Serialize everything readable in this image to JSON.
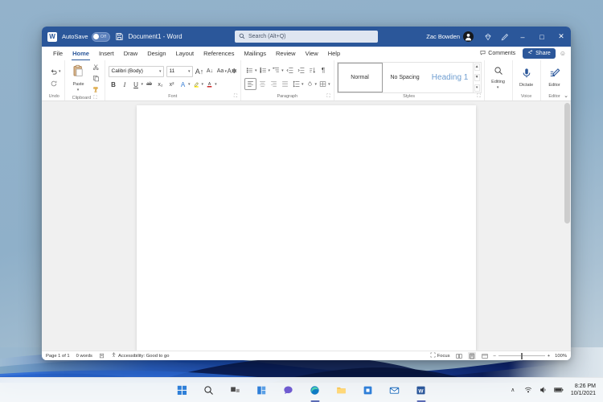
{
  "desktop": {
    "wallpaper_name": "windows-11-bloom",
    "bg_color": "#8fb0c9"
  },
  "window": {
    "titlebar": {
      "app_icon": "word-icon",
      "autosave_label": "AutoSave",
      "autosave_state": "Off",
      "save_icon": "save-icon",
      "document_title": "Document1  -  Word",
      "search_icon": "search-icon",
      "search_placeholder": "Search (Alt+Q)",
      "search_value": "",
      "search_dictate_icon": "microphone-icon",
      "user_name": "Zac Bowden",
      "avatar_icon": "avatar-icon",
      "diamond_icon": "microsoft-365-icon",
      "pen_icon": "ink-pen-icon",
      "minimize_label": "–",
      "maximize_label": "□",
      "close_label": "✕"
    },
    "tabs": [
      {
        "label": "File",
        "active": false
      },
      {
        "label": "Home",
        "active": true
      },
      {
        "label": "Insert",
        "active": false
      },
      {
        "label": "Draw",
        "active": false
      },
      {
        "label": "Design",
        "active": false
      },
      {
        "label": "Layout",
        "active": false
      },
      {
        "label": "References",
        "active": false
      },
      {
        "label": "Mailings",
        "active": false
      },
      {
        "label": "Review",
        "active": false
      },
      {
        "label": "View",
        "active": false
      },
      {
        "label": "Help",
        "active": false
      }
    ],
    "tabs_right": {
      "comments_label": "Comments",
      "comments_icon": "comment-icon",
      "share_label": "Share",
      "share_icon": "share-icon",
      "emoji_label": "☺"
    },
    "ribbon": {
      "undo": {
        "label": "Undo",
        "undo_icon": "undo-arrow-icon",
        "redo_icon": "redo-arrow-icon"
      },
      "clipboard": {
        "label": "Clipboard",
        "paste_label": "Paste",
        "paste_icon": "clipboard-icon",
        "cut_icon": "scissors-icon",
        "copy_icon": "copy-icon",
        "format_painter_icon": "format-painter-icon",
        "dialog_icon": "dialog-launcher-icon"
      },
      "font": {
        "label": "Font",
        "font_name": "Calibri (Body)",
        "font_size": "11",
        "grow_font_label": "A",
        "shrink_font_label": "A",
        "change_case_label": "Aa",
        "clear_formatting_label": "A",
        "bold_label": "B",
        "italic_label": "I",
        "underline_label": "U",
        "strikethrough_label": "ab",
        "subscript_label": "x₂",
        "superscript_label": "x²",
        "text_effects_label": "A",
        "highlight_label": "✎",
        "font_color_label": "A",
        "dialog_icon": "dialog-launcher-icon"
      },
      "paragraph": {
        "label": "Paragraph",
        "bullets_icon": "bullet-list-icon",
        "numbering_icon": "numbered-list-icon",
        "multilevel_icon": "multilevel-list-icon",
        "decrease_indent_icon": "decrease-indent-icon",
        "increase_indent_icon": "increase-indent-icon",
        "sort_icon": "sort-icon",
        "show_marks_icon": "pilcrow-icon",
        "align_left_icon": "align-left-icon",
        "align_center_icon": "align-center-icon",
        "align_right_icon": "align-right-icon",
        "justify_icon": "justify-icon",
        "line_spacing_icon": "line-spacing-icon",
        "shading_icon": "shading-icon",
        "borders_icon": "borders-icon",
        "dialog_icon": "dialog-launcher-icon"
      },
      "styles": {
        "label": "Styles",
        "items": [
          {
            "name": "Normal",
            "selected": true
          },
          {
            "name": "No Spacing",
            "selected": false
          },
          {
            "name": "Heading 1",
            "selected": false
          }
        ],
        "scroll_up": "▲",
        "scroll_down": "▼",
        "more": "▾",
        "dialog_icon": "dialog-launcher-icon"
      },
      "editing": {
        "label": "Editing",
        "icon": "magnifier-icon",
        "caret": "▾"
      },
      "voice": {
        "label": "Voice",
        "dictate_label": "Dictate",
        "dictate_icon": "microphone-icon"
      },
      "editor": {
        "label": "Editor",
        "editor_label": "Editor",
        "editor_icon": "editor-pen-icon"
      },
      "collapse_label": "⌄"
    },
    "statusbar": {
      "page_label": "Page 1 of 1",
      "word_count": "0 words",
      "language_icon": "proofing-icon",
      "accessibility_icon": "accessibility-icon",
      "accessibility_label": "Accessibility: Good to go",
      "focus_label": "Focus",
      "focus_icon": "focus-icon",
      "view_read_icon": "read-mode-icon",
      "view_print_icon": "print-layout-icon",
      "view_web_icon": "web-layout-icon",
      "zoom_out": "–",
      "zoom_in": "+",
      "zoom_level": "100%"
    }
  },
  "taskbar": {
    "items": [
      {
        "name": "start-button",
        "label": "Start"
      },
      {
        "name": "search-button",
        "label": "Search"
      },
      {
        "name": "task-view-button",
        "label": "Task View"
      },
      {
        "name": "widgets-button",
        "label": "Widgets"
      },
      {
        "name": "chat-button",
        "label": "Chat"
      },
      {
        "name": "edge-button",
        "label": "Microsoft Edge"
      },
      {
        "name": "file-explorer-button",
        "label": "File Explorer"
      },
      {
        "name": "store-button",
        "label": "Microsoft Store"
      },
      {
        "name": "mail-button",
        "label": "Mail"
      },
      {
        "name": "word-taskbar-button",
        "label": "Word"
      }
    ],
    "tray": {
      "chevron": "∧",
      "wifi_icon": "wifi-icon",
      "volume_icon": "volume-icon",
      "battery_icon": "battery-icon",
      "time": "8:26 PM",
      "date": "10/1/2021"
    }
  }
}
